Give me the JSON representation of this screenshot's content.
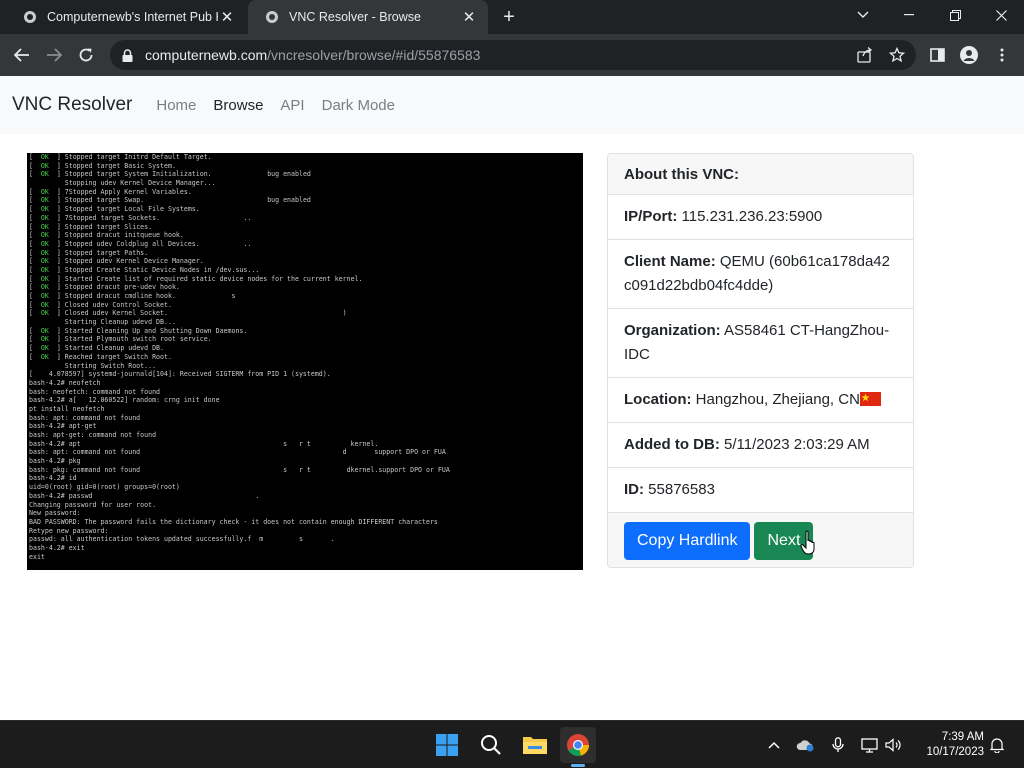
{
  "browser": {
    "tabs": [
      {
        "title": "Computernewb's Internet Pub H",
        "active": false
      },
      {
        "title": "VNC Resolver - Browse",
        "active": true
      }
    ],
    "url_host": "computernewb.com",
    "url_path": "/vncresolver/browse/#id/55876583"
  },
  "site": {
    "brand": "VNC Resolver",
    "nav": [
      {
        "label": "Home",
        "active": false
      },
      {
        "label": "Browse",
        "active": true
      },
      {
        "label": "API",
        "active": false
      },
      {
        "label": "Dark Mode",
        "active": false
      }
    ]
  },
  "terminal_lines": [
    "[  OK  ] Stopped target Initrd Default Target.",
    "[  OK  ] Stopped target Basic System.",
    "[  OK  ] Stopped target System Initialization.              bug enabled",
    "         Stopping udev Kernel Device Manager...",
    "[  OK  ] 7Stopped Apply Kernel Variables.",
    "[  OK  ] Stopped target Swap.                               bug enabled",
    "[  OK  ] Stopped target Local File Systems.",
    "[  OK  ] 7Stopped target Sockets.                     ..",
    "[  OK  ] Stopped target Slices.",
    "[  OK  ] Stopped dracut initqueue hook.",
    "[  OK  ] Stopped udev Coldplug all Devices.           ..",
    "[  OK  ] Stopped target Paths.",
    "[  OK  ] Stopped udev Kernel Device Manager.",
    "[  OK  ] Stopped Create Static Device Nodes in /dev.sus...",
    "[  OK  ] Started Create list of required static device nodes for the current kernel.",
    "[  OK  ] Stopped dracut pre-udev hook.",
    "[  OK  ] Stopped dracut cmdline hook.              s",
    "[  OK  ] Closed udev Control Socket.",
    "[  OK  ] Closed udev Kernel Socket.                                            )",
    "         Starting Cleanup udevd DB...",
    "[  OK  ] Started Cleaning Up and Shutting Down Daemons.",
    "[  OK  ] Started Plymouth switch root service.",
    "[  OK  ] Started Cleanup udevd DB.",
    "[  OK  ] Reached target Switch Root.",
    "         Starting Switch Root...",
    "[    4.078597] systemd-journald[104]: Received SIGTERM from PID 1 (systemd).",
    "bash-4.2# neofetch",
    "bash: neofetch: command not found",
    "bash-4.2# a[   12.060522] random: crng init done",
    "pt install neofetch",
    "bash: apt: command not found",
    "bash-4.2# apt-get",
    "bash: apt-get: command not found",
    "bash-4.2# apt                                                   s   r t          kernel.",
    "bash: apt: command not found                                                   d       support DPO or FUA",
    "bash-4.2# pkg",
    "bash: pkg: command not found                                    s   r t         dkernel.support DPO or FUA",
    "bash-4.2# id",
    "uid=0(root) gid=0(root) groups=0(root)",
    "bash-4.2# passwd                                         .",
    "Changing password for user root.",
    "New password:",
    "BAD PASSWORD: The password fails the dictionary check - it does not contain enough DIFFERENT characters",
    "Retype new password:",
    "passwd: all authentication tokens updated successfully.f  m         s       .",
    "bash-4.2# exit",
    "exit"
  ],
  "card": {
    "header": "About this VNC:",
    "ip_label": "IP/Port:",
    "ip_value": "115.231.236.23:5900",
    "client_label": "Client Name:",
    "client_value": "QEMU (60b61ca178da42c091d22bdb04fc4dde)",
    "org_label": "Organization:",
    "org_value": "AS58461 CT-HangZhou-IDC",
    "loc_label": "Location:",
    "loc_value": "Hangzhou, Zhejiang, CN",
    "added_label": "Added to DB:",
    "added_value": "5/11/2023 2:03:29 AM",
    "id_label": "ID:",
    "id_value": "55876583",
    "copy_button": "Copy Hardlink",
    "next_button": "Next"
  },
  "taskbar": {
    "time": "7:39 AM",
    "date": "10/17/2023"
  },
  "colors": {
    "primary": "#0d6efd",
    "success": "#198754",
    "terminal_ok": "#4cd24c"
  }
}
